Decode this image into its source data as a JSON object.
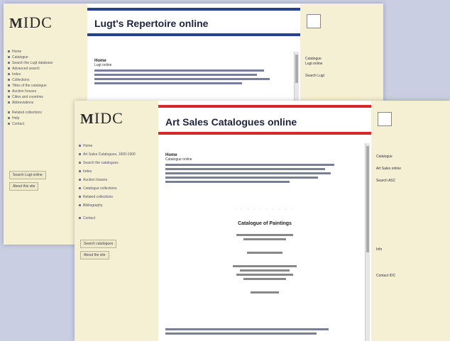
{
  "back": {
    "logo_mark": "M",
    "logo_text": "IDC",
    "title": "Lugt's Repertoire online",
    "nav_items": [
      "Home",
      "Catalogue",
      "Search the Lugt database",
      "Advanced search",
      "Index",
      "Collections",
      "Titles of the catalogue",
      "Auction houses",
      "Cities and countries",
      "Abbreviations",
      "Related collections",
      "Help",
      "Contact"
    ],
    "buttons": [
      "Search Lugt online",
      "About this site"
    ],
    "content_heading": "Home",
    "content_sub": "Lugt online",
    "side_info": [
      "Catalogue",
      "Lugt online",
      "Search Lugt"
    ]
  },
  "front": {
    "logo_mark": "M",
    "logo_text": "IDC",
    "title": "Art Sales Catalogues online",
    "nav_items": [
      "Home",
      "Art Sales Catalogues, 1600-1900",
      "Search the catalogues",
      "Index",
      "Auction houses",
      "Catalogue collections",
      "Related collections",
      "Bibliography",
      "Contact"
    ],
    "buttons": [
      "Search catalogues",
      "About the site"
    ],
    "content_heading": "Home",
    "content_sub": "Catalogue online",
    "center_big": "Catalogue of Paintings",
    "side_info": [
      "Catalogue",
      "Art Sales online",
      "Search ASC",
      "Info",
      "Contact IDC"
    ]
  }
}
